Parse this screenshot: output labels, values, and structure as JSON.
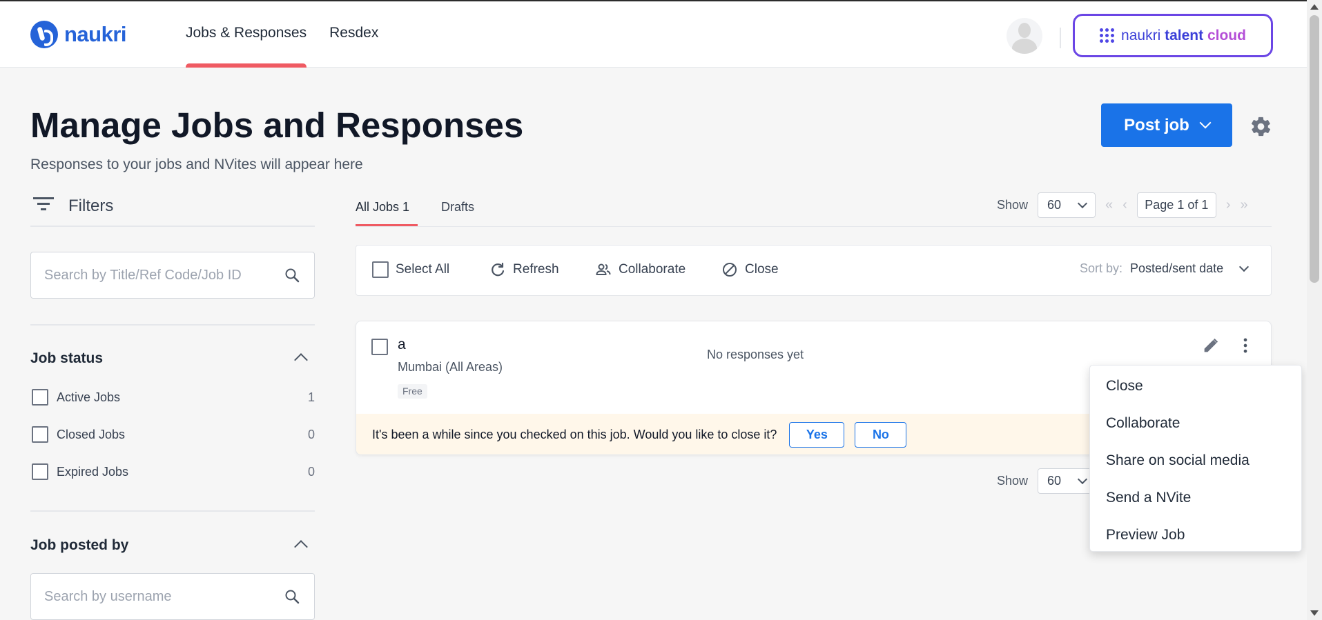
{
  "header": {
    "logo_text": "naukri",
    "nav": [
      "Jobs & Responses",
      "Resdex"
    ],
    "talent_cloud": {
      "prefix": "naukri",
      "talent": "talent",
      "cloud": "cloud"
    }
  },
  "page": {
    "title": "Manage Jobs and Responses",
    "subtitle": "Responses to your jobs and NVites will appear here",
    "post_job": "Post job"
  },
  "filters": {
    "label": "Filters",
    "search_placeholder": "Search by Title/Ref Code/Job ID",
    "job_status": {
      "title": "Job status",
      "items": [
        {
          "label": "Active Jobs",
          "count": "1"
        },
        {
          "label": "Closed Jobs",
          "count": "0"
        },
        {
          "label": "Expired Jobs",
          "count": "0"
        }
      ]
    },
    "job_posted_by": {
      "title": "Job posted by",
      "search_placeholder": "Search by username"
    }
  },
  "tabs": [
    "All Jobs 1",
    "Drafts"
  ],
  "pagination": {
    "show_label": "Show",
    "show_value": "60",
    "page_text": "Page 1 of 1"
  },
  "toolbar": {
    "select_all": "Select All",
    "refresh": "Refresh",
    "collaborate": "Collaborate",
    "close": "Close",
    "sort_label": "Sort by:",
    "sort_value": "Posted/sent date"
  },
  "job": {
    "title": "a",
    "location": "Mumbai (All Areas)",
    "badge": "Free",
    "responses": "No responses yet",
    "prompt": "It's been a while since you checked on this job. Would you like to close it?",
    "yes": "Yes",
    "no": "No"
  },
  "job_menu": [
    "Close",
    "Collaborate",
    "Share on social media",
    "Send a NVite",
    "Preview Job"
  ],
  "colors": {
    "accent": "#1a73e8",
    "active_tab": "#ef5a62",
    "brand": "#2563d8"
  }
}
